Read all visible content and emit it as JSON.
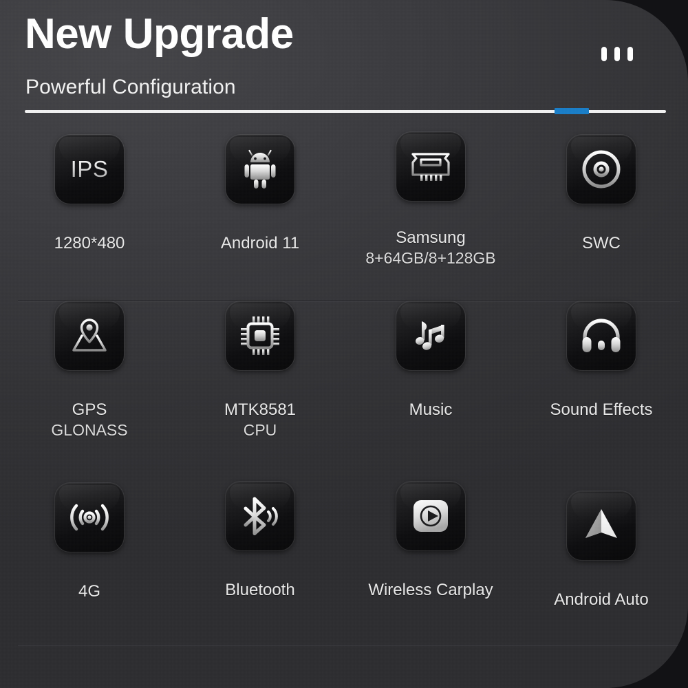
{
  "header": {
    "title": "New Upgrade",
    "subtitle": "Powerful Configuration",
    "menu_icon": "vertical-dots-icon",
    "progress": {
      "accent_color": "#1a7ec8",
      "track_color": "#f2f2f2"
    }
  },
  "theme": {
    "panel_background": "#3a3a3e",
    "stage_background": "#121215",
    "tile_background": "#111113",
    "text_color": "#e8e8e8",
    "accent_color": "#1a7ec8"
  },
  "grid": {
    "rows": [
      {
        "cells": [
          {
            "icon": "ips-text-icon",
            "tile_text": "IPS",
            "label": "1280*480",
            "sublabel": ""
          },
          {
            "icon": "android-robot-icon",
            "tile_text": "",
            "label": "Android 11",
            "sublabel": ""
          },
          {
            "icon": "memory-chip-icon",
            "tile_text": "",
            "label": "Samsung",
            "sublabel": "8+64GB/8+128GB"
          },
          {
            "icon": "steering-wheel-icon",
            "tile_text": "",
            "label": "SWC",
            "sublabel": ""
          }
        ]
      },
      {
        "cells": [
          {
            "icon": "map-pin-icon",
            "tile_text": "",
            "label": "GPS",
            "sublabel": "GLONASS"
          },
          {
            "icon": "cpu-chip-icon",
            "tile_text": "",
            "label": "MTK8581",
            "sublabel": "CPU"
          },
          {
            "icon": "music-notes-icon",
            "tile_text": "",
            "label": "Music",
            "sublabel": ""
          },
          {
            "icon": "headphones-icon",
            "tile_text": "",
            "label": "Sound Effects",
            "sublabel": ""
          }
        ]
      },
      {
        "cells": [
          {
            "icon": "wireless-signal-icon",
            "tile_text": "",
            "label": "4G",
            "sublabel": ""
          },
          {
            "icon": "bluetooth-icon",
            "tile_text": "",
            "label": "Bluetooth",
            "sublabel": ""
          },
          {
            "icon": "carplay-icon",
            "tile_text": "",
            "label": "Wireless Carplay",
            "sublabel": ""
          },
          {
            "icon": "android-auto-icon",
            "tile_text": "",
            "label": "Android Auto",
            "sublabel": ""
          }
        ]
      }
    ]
  }
}
